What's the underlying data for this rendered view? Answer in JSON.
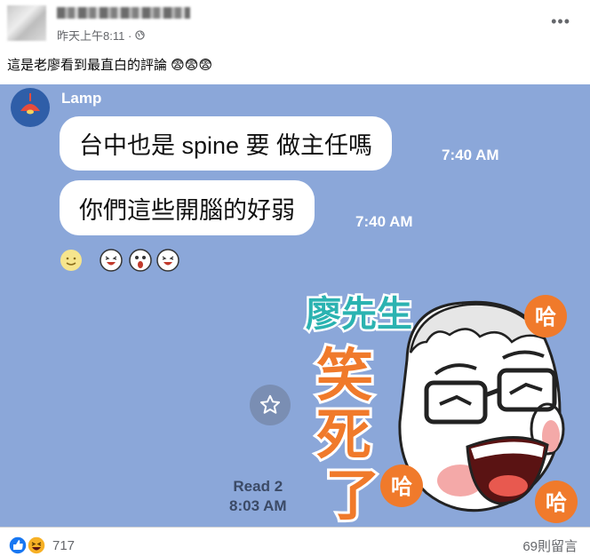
{
  "post": {
    "timestamp": "昨天上午8:11 ·",
    "caption": "這是老廖看到最直白的評論 😨😨😨"
  },
  "chat": {
    "sender": "Lamp",
    "messages": [
      {
        "text": "台中也是 spine 要 做主任嗎",
        "time": "7:40 AM"
      },
      {
        "text": "你們這些開腦的好弱",
        "time": "7:40 AM"
      }
    ],
    "read_label": "Read 2",
    "read_time": "8:03 AM"
  },
  "sticker": {
    "title": "廖先生",
    "text_laugh": "笑",
    "text_die": "死",
    "text_le": "了",
    "ha": "哈"
  },
  "footer": {
    "reaction_count": "717",
    "comment_count": "69則留言"
  },
  "colors": {
    "chat_bg": "#8ba7d9",
    "bubble": "#ffffff",
    "like_blue": "#1877f2",
    "sticker_orange": "#f07a2b",
    "sticker_teal": "#2bb3b1"
  }
}
